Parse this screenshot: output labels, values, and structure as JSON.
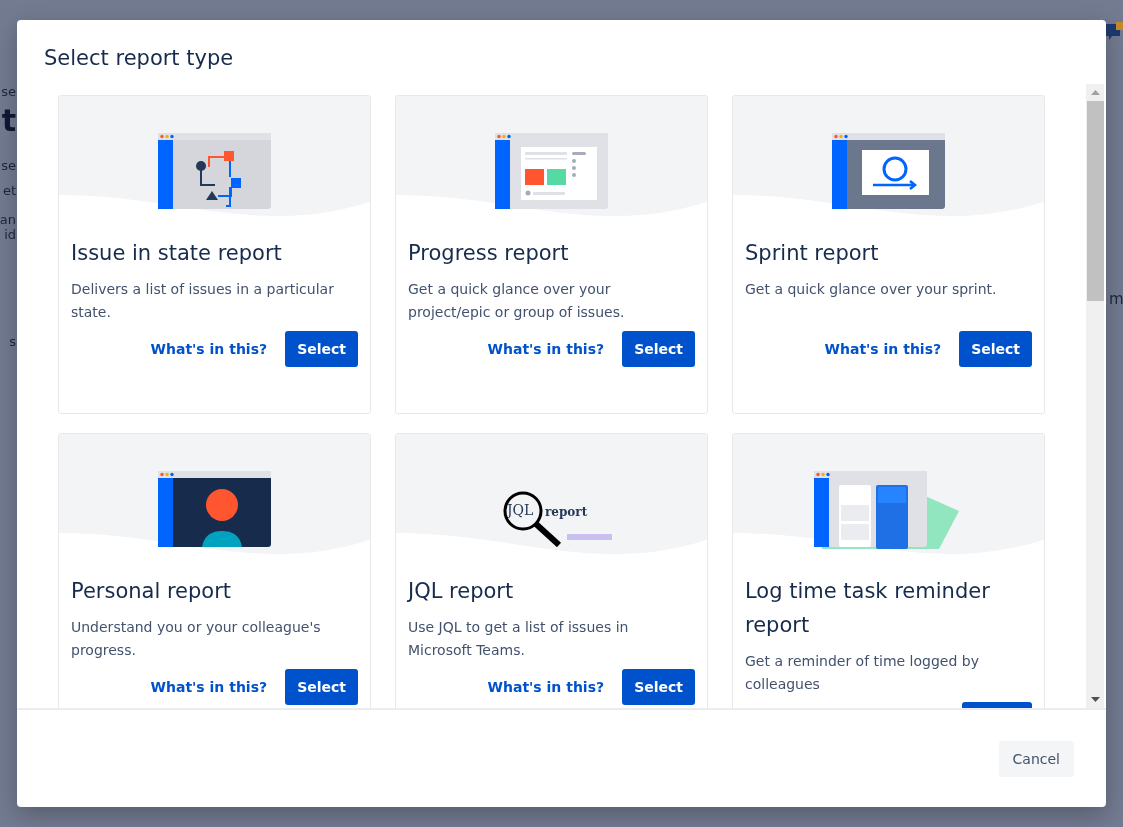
{
  "background": {
    "fragments": [
      "se",
      "t",
      "se",
      "et",
      "an",
      "id",
      "s"
    ],
    "right_fragments": [
      "m"
    ]
  },
  "dialog": {
    "title": "Select report type",
    "cards": [
      {
        "kind": "flow",
        "title": "Issue in state report",
        "description": "Delivers a list of issues in a particular state.",
        "link": "What's in this?",
        "button": "Select"
      },
      {
        "kind": "progress",
        "title": "Progress report",
        "description": "Get a quick glance over your project/epic or group of issues.",
        "link": "What's in this?",
        "button": "Select"
      },
      {
        "kind": "sprint",
        "title": "Sprint report",
        "description": "Get a quick glance over your sprint.",
        "link": "What's in this?",
        "button": "Select"
      },
      {
        "kind": "person",
        "title": "Personal report",
        "description": "Understand you or your colleague's progress.",
        "link": "What's in this?",
        "button": "Select"
      },
      {
        "kind": "jql",
        "title": "JQL report",
        "description": "Use JQL to get a list of issues in Microsoft Teams.",
        "link": "What's in this?",
        "button": "Select",
        "illustration_label": "JQL",
        "illustration_caption": "report"
      },
      {
        "kind": "log",
        "title": "Log time task reminder report",
        "description": "Get a reminder of time logged by colleagues",
        "partial_button": true
      }
    ],
    "cancel": "Cancel"
  }
}
